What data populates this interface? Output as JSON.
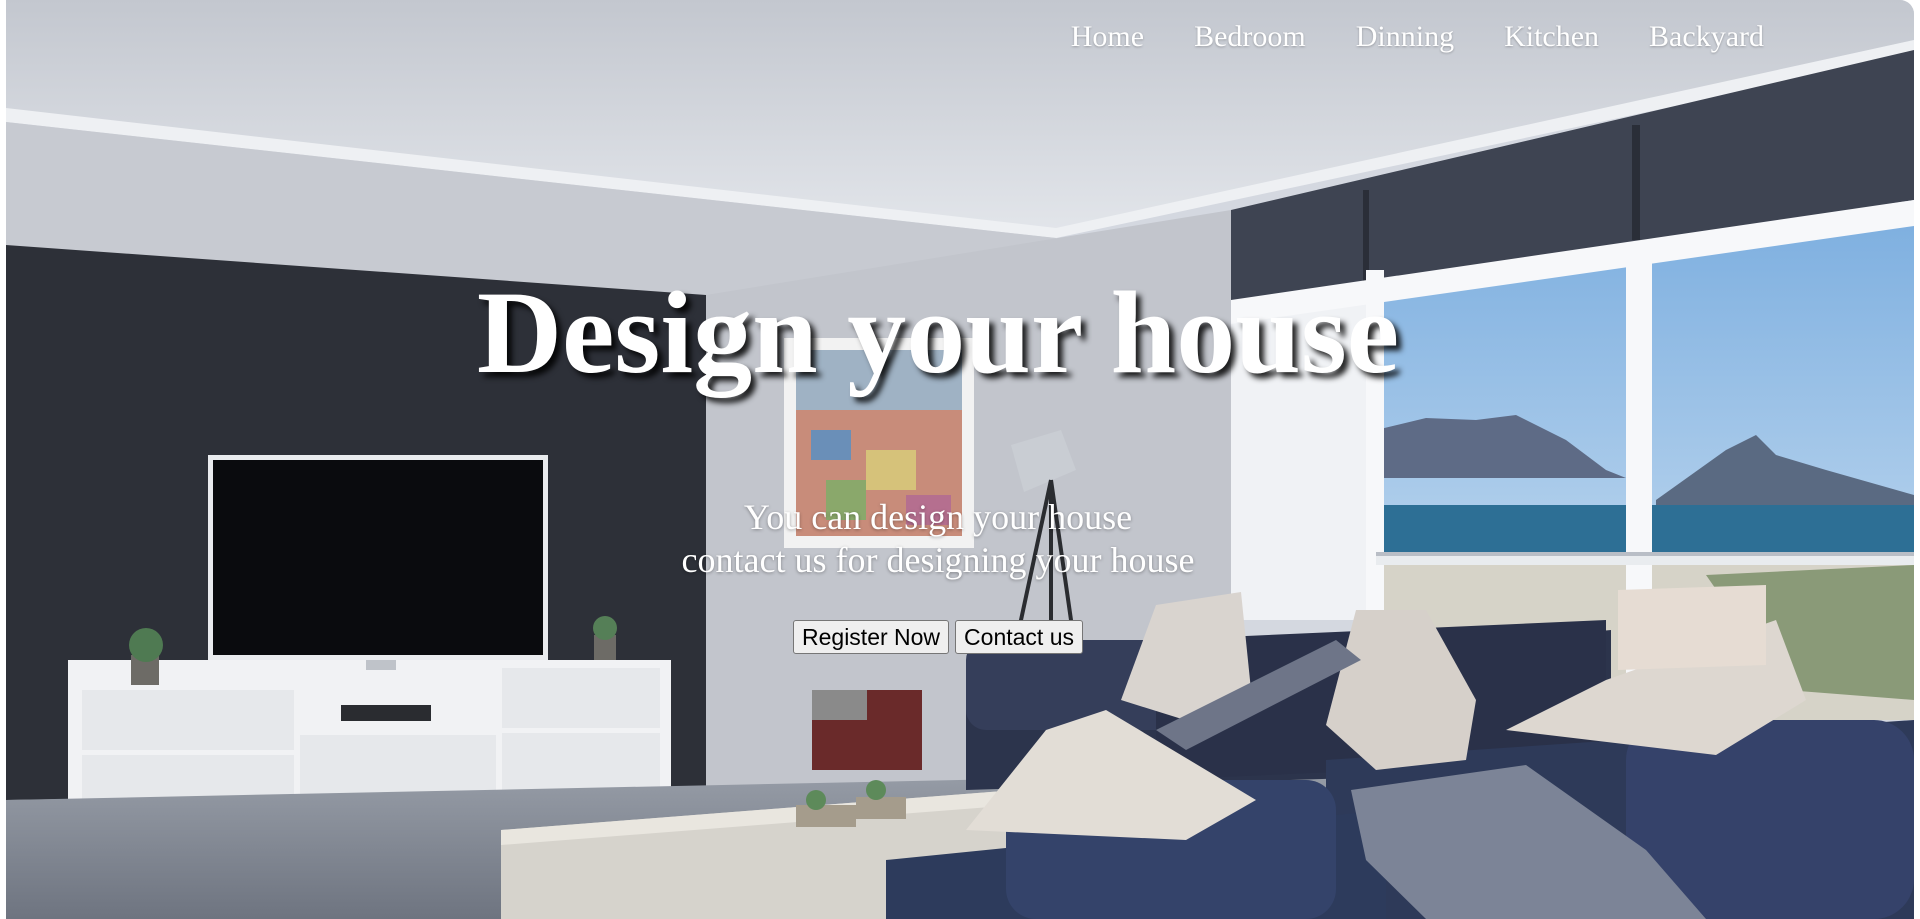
{
  "nav": {
    "items": [
      {
        "label": "Home"
      },
      {
        "label": "Bedroom"
      },
      {
        "label": "Dinning"
      },
      {
        "label": "Kitchen"
      },
      {
        "label": "Backyard"
      }
    ]
  },
  "hero": {
    "title": "Design your house",
    "subtitle_line1": "You can design your house",
    "subtitle_line2": "contact us for designing your house",
    "register_label": "Register Now",
    "contact_label": "Contact us"
  },
  "colors": {
    "text": "#ffffff",
    "wall_dark": "#2d3038",
    "sofa": "#2f3a55",
    "sea": "#2d6f95",
    "sky": "#bfd8ee"
  }
}
